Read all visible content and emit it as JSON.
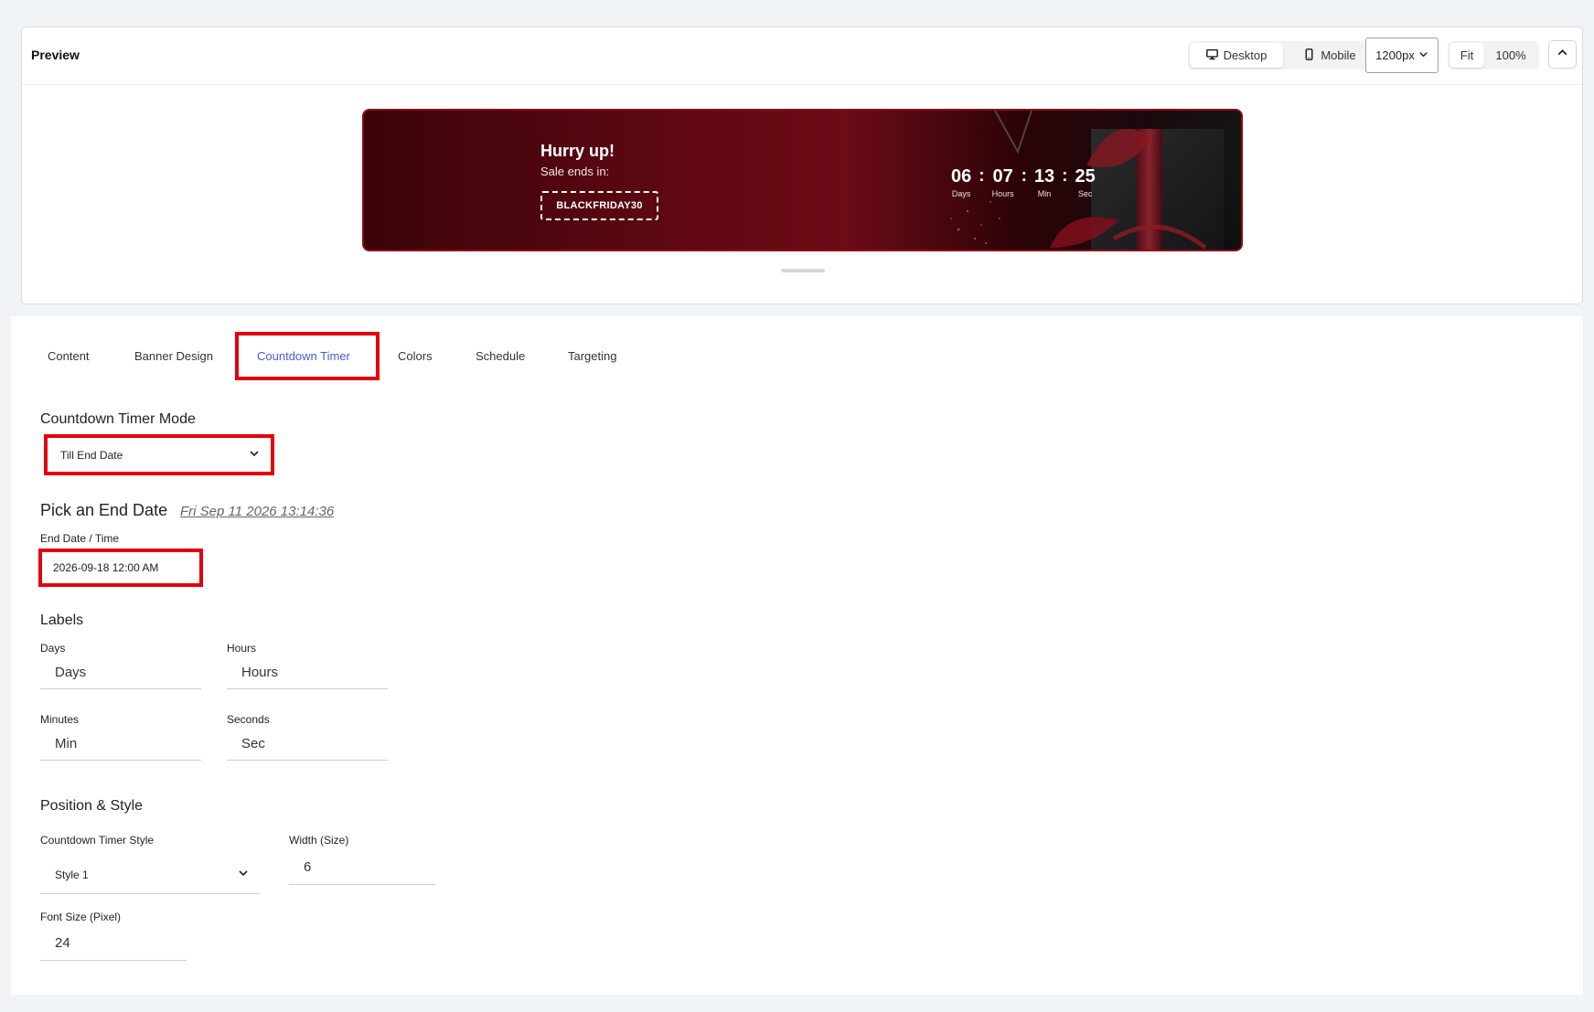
{
  "preview": {
    "title": "Preview",
    "devices": [
      {
        "label": "Desktop",
        "icon": "desktop-icon",
        "active": true
      },
      {
        "label": "Mobile",
        "icon": "mobile-icon",
        "active": false
      }
    ],
    "width_select": "1200px",
    "zoom": [
      {
        "label": "Fit",
        "active": true
      },
      {
        "label": "100%",
        "active": false
      }
    ]
  },
  "banner": {
    "headline": "Hurry up!",
    "subtext": "Sale ends in:",
    "coupon": "BLACKFRIDAY30",
    "timer": [
      {
        "value": "06",
        "label": "Days"
      },
      {
        "value": "07",
        "label": "Hours"
      },
      {
        "value": "13",
        "label": "Min"
      },
      {
        "value": "25",
        "label": "Sec"
      }
    ],
    "separator": ":"
  },
  "tabs": [
    "Content",
    "Banner Design",
    "Countdown Timer",
    "Colors",
    "Schedule",
    "Targeting"
  ],
  "active_tab": "Countdown Timer",
  "countdown": {
    "mode_title": "Countdown Timer Mode",
    "mode_value": "Till End Date",
    "end_date_title": "Pick an End Date",
    "end_date_display": "Fri Sep 11 2026 13:14:36",
    "end_date_label": "End Date / Time",
    "end_date_value": "2026-09-18 12:00 AM"
  },
  "labels": {
    "title": "Labels",
    "days_label": "Days",
    "days_value": "Days",
    "hours_label": "Hours",
    "hours_value": "Hours",
    "minutes_label": "Minutes",
    "minutes_value": "Min",
    "seconds_label": "Seconds",
    "seconds_value": "Sec"
  },
  "position_style": {
    "title": "Position & Style",
    "style_label": "Countdown Timer Style",
    "style_value": "Style 1",
    "width_label": "Width (Size)",
    "width_value": "6",
    "font_label": "Font Size (Pixel)",
    "font_value": "24"
  },
  "colors": {
    "highlight": "#e3000f",
    "active_tab": "#4c5bd4",
    "banner_border": "#8a0e1a"
  }
}
